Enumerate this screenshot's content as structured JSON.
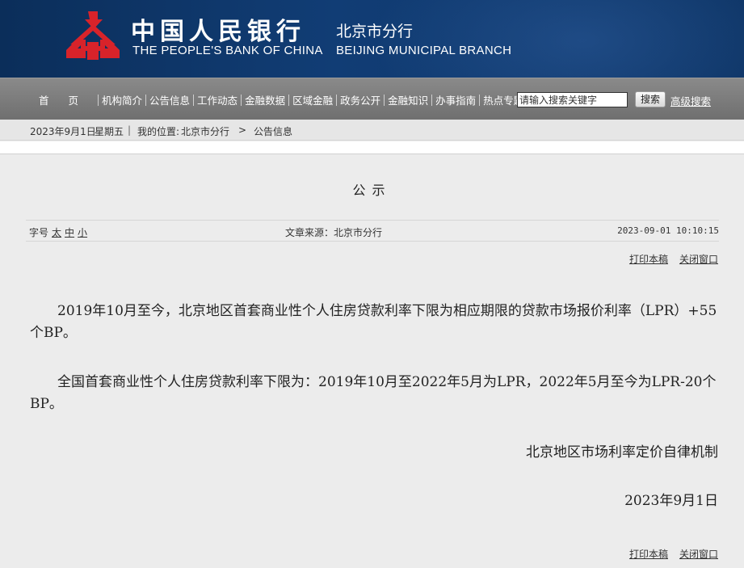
{
  "header": {
    "cn_name": "中国人民银行",
    "en_name": "THE PEOPLE'S BANK OF CHINA",
    "branch_cn": "北京市分行",
    "branch_en": "BEIJING MUNICIPAL BRANCH",
    "logo_color": "#d8232a"
  },
  "nav": {
    "items": [
      "首页",
      "机构简介",
      "公告信息",
      "工作动态",
      "金融数据",
      "区域金融",
      "政务公开",
      "金融知识",
      "办事指南",
      "热点专题"
    ],
    "search_placeholder": "请输入搜索关键字",
    "search_button": "搜索",
    "advanced_search": "高级搜索"
  },
  "infobar": {
    "date": "2023年9月1日",
    "weekday": "星期五",
    "location_label": "我的位置:",
    "location": "北京市分行",
    "arrow": ">",
    "current": "公告信息"
  },
  "article": {
    "title": "公示",
    "font_label": "字号",
    "font_sizes": [
      "太",
      "中",
      "小"
    ],
    "source": "文章来源：北京市分行",
    "datetime": "2023-09-01 10:10:15",
    "print": "打印本稿",
    "close": "关闭窗口",
    "paragraph1": "2019年10月至今，北京地区首套商业性个人住房贷款利率下限为相应期限的贷款市场报价利率（LPR）+55个BP。",
    "paragraph2": "全国首套商业性个人住房贷款利率下限为：2019年10月至2022年5月为LPR，2022年5月至今为LPR-20个BP。",
    "signature": "北京地区市场利率定价自律机制",
    "sign_date": "2023年9月1日"
  }
}
